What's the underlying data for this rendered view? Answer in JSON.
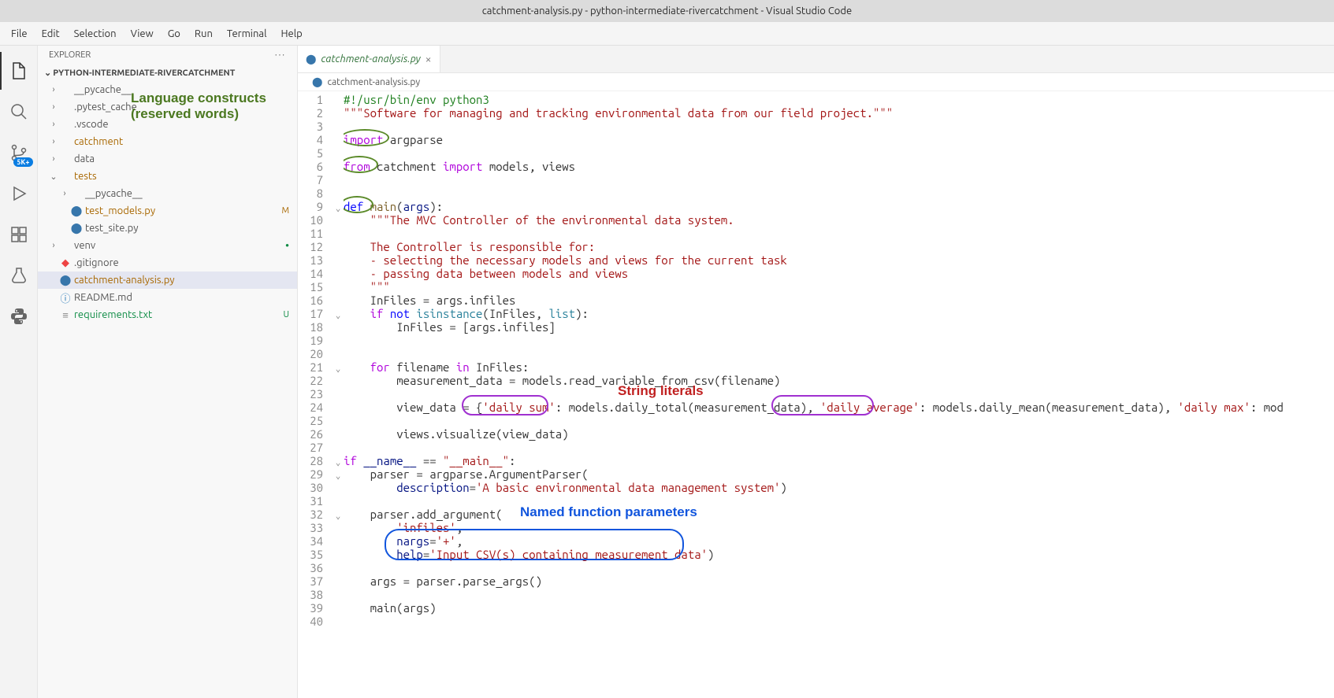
{
  "window": {
    "title": "catchment-analysis.py - python-intermediate-rivercatchment - Visual Studio Code"
  },
  "menu": [
    "File",
    "Edit",
    "Selection",
    "View",
    "Go",
    "Run",
    "Terminal",
    "Help"
  ],
  "sidebar": {
    "header": "EXPLORER",
    "project": "PYTHON-INTERMEDIATE-RIVERCATCHMENT",
    "items": [
      {
        "indent": 1,
        "type": "folder-closed",
        "label": "__pycache__"
      },
      {
        "indent": 1,
        "type": "folder-closed",
        "label": ".pytest_cache"
      },
      {
        "indent": 1,
        "type": "folder-closed",
        "label": ".vscode"
      },
      {
        "indent": 1,
        "type": "folder-closed",
        "label": "catchment",
        "gitClass": "dir-modified"
      },
      {
        "indent": 1,
        "type": "folder-closed",
        "label": "data"
      },
      {
        "indent": 1,
        "type": "folder-open",
        "label": "tests",
        "gitClass": "dir-modified"
      },
      {
        "indent": 2,
        "type": "folder-closed",
        "label": "__pycache__"
      },
      {
        "indent": 2,
        "type": "python",
        "label": "test_models.py",
        "gitClass": "git-modified",
        "status": "M"
      },
      {
        "indent": 2,
        "type": "python",
        "label": "test_site.py"
      },
      {
        "indent": 1,
        "type": "folder-closed",
        "label": "venv",
        "dot": true
      },
      {
        "indent": 1,
        "type": "git",
        "label": ".gitignore"
      },
      {
        "indent": 1,
        "type": "python",
        "label": "catchment-analysis.py",
        "gitClass": "git-modified",
        "selected": true
      },
      {
        "indent": 1,
        "type": "info",
        "label": "README.md"
      },
      {
        "indent": 1,
        "type": "text",
        "label": "requirements.txt",
        "gitClass": "git-untracked",
        "status": "U"
      }
    ]
  },
  "tab": {
    "filename": "catchment-analysis.py"
  },
  "breadcrumb": {
    "file": "catchment-analysis.py"
  },
  "sourceControlBadge": "5K+",
  "annotations": {
    "green": "Language constructs\n(reserved words)",
    "red": "String literals",
    "blue": "Named function parameters"
  },
  "code": {
    "lines": [
      [
        {
          "c": "tk-comment",
          "t": "#!/usr/bin/env python3"
        }
      ],
      [
        {
          "c": "tk-docstring",
          "t": "\"\"\"Software for managing and tracking environmental data from our field project.\"\"\""
        }
      ],
      [],
      [
        {
          "c": "tk-import",
          "t": "import"
        },
        {
          "t": " argparse"
        }
      ],
      [],
      [
        {
          "c": "tk-import",
          "t": "from"
        },
        {
          "t": " catchment "
        },
        {
          "c": "tk-import",
          "t": "import"
        },
        {
          "t": " models, views"
        }
      ],
      [],
      [],
      [
        {
          "c": "tk-def",
          "t": "def"
        },
        {
          "t": " "
        },
        {
          "c": "tk-func",
          "t": "main"
        },
        {
          "t": "("
        },
        {
          "c": "tk-param",
          "t": "args"
        },
        {
          "t": "):"
        }
      ],
      [
        {
          "t": "    "
        },
        {
          "c": "tk-docstring",
          "t": "\"\"\"The MVC Controller of the environmental data system."
        }
      ],
      [],
      [
        {
          "c": "tk-docstring",
          "t": "    The Controller is responsible for:"
        }
      ],
      [
        {
          "c": "tk-docstring",
          "t": "    - selecting the necessary models and views for the current task"
        }
      ],
      [
        {
          "c": "tk-docstring",
          "t": "    - passing data between models and views"
        }
      ],
      [
        {
          "c": "tk-docstring",
          "t": "    \"\"\""
        }
      ],
      [
        {
          "t": "    InFiles = args.infiles"
        }
      ],
      [
        {
          "t": "    "
        },
        {
          "c": "tk-keyword2",
          "t": "if"
        },
        {
          "t": " "
        },
        {
          "c": "tk-keyword",
          "t": "not"
        },
        {
          "t": " "
        },
        {
          "c": "tk-builtin",
          "t": "isinstance"
        },
        {
          "t": "(InFiles, "
        },
        {
          "c": "tk-builtin",
          "t": "list"
        },
        {
          "t": "):"
        }
      ],
      [
        {
          "t": "        InFiles = [args.infiles]"
        }
      ],
      [],
      [],
      [
        {
          "t": "    "
        },
        {
          "c": "tk-keyword2",
          "t": "for"
        },
        {
          "t": " filename "
        },
        {
          "c": "tk-keyword2",
          "t": "in"
        },
        {
          "t": " InFiles:"
        }
      ],
      [
        {
          "t": "        measurement_data = models.read_variable_from_csv(filename)"
        }
      ],
      [],
      [
        {
          "t": "        view_data = {"
        },
        {
          "c": "tk-string",
          "t": "'daily sum'"
        },
        {
          "t": ": models.daily_total(measurement_data), "
        },
        {
          "c": "tk-string",
          "t": "'daily average'"
        },
        {
          "t": ": models.daily_mean(measurement_data), "
        },
        {
          "c": "tk-string",
          "t": "'daily max'"
        },
        {
          "t": ": mod"
        }
      ],
      [],
      [
        {
          "t": "        views.visualize(view_data)"
        }
      ],
      [],
      [
        {
          "c": "tk-keyword2",
          "t": "if"
        },
        {
          "t": " "
        },
        {
          "c": "tk-var",
          "t": "__name__"
        },
        {
          "t": " == "
        },
        {
          "c": "tk-string",
          "t": "\"__main__\""
        },
        {
          "t": ":"
        }
      ],
      [
        {
          "t": "    parser = argparse.ArgumentParser("
        }
      ],
      [
        {
          "t": "        "
        },
        {
          "c": "tk-param",
          "t": "description"
        },
        {
          "t": "="
        },
        {
          "c": "tk-string",
          "t": "'A basic environmental data management system'"
        },
        {
          "t": ")"
        }
      ],
      [],
      [
        {
          "t": "    parser.add_argument("
        }
      ],
      [
        {
          "t": "        "
        },
        {
          "c": "tk-string",
          "t": "'infiles'"
        },
        {
          "t": ","
        }
      ],
      [
        {
          "t": "        "
        },
        {
          "c": "tk-param",
          "t": "nargs"
        },
        {
          "t": "="
        },
        {
          "c": "tk-string",
          "t": "'+'"
        },
        {
          "t": ","
        }
      ],
      [
        {
          "t": "        "
        },
        {
          "c": "tk-param",
          "t": "help"
        },
        {
          "t": "="
        },
        {
          "c": "tk-string",
          "t": "'Input CSV(s) containing measurement data'"
        },
        {
          "t": ")"
        }
      ],
      [],
      [
        {
          "t": "    args = parser.parse_args()"
        }
      ],
      [],
      [
        {
          "t": "    main(args)"
        }
      ],
      []
    ],
    "foldLines": [
      9,
      17,
      21,
      28,
      29,
      32
    ]
  }
}
